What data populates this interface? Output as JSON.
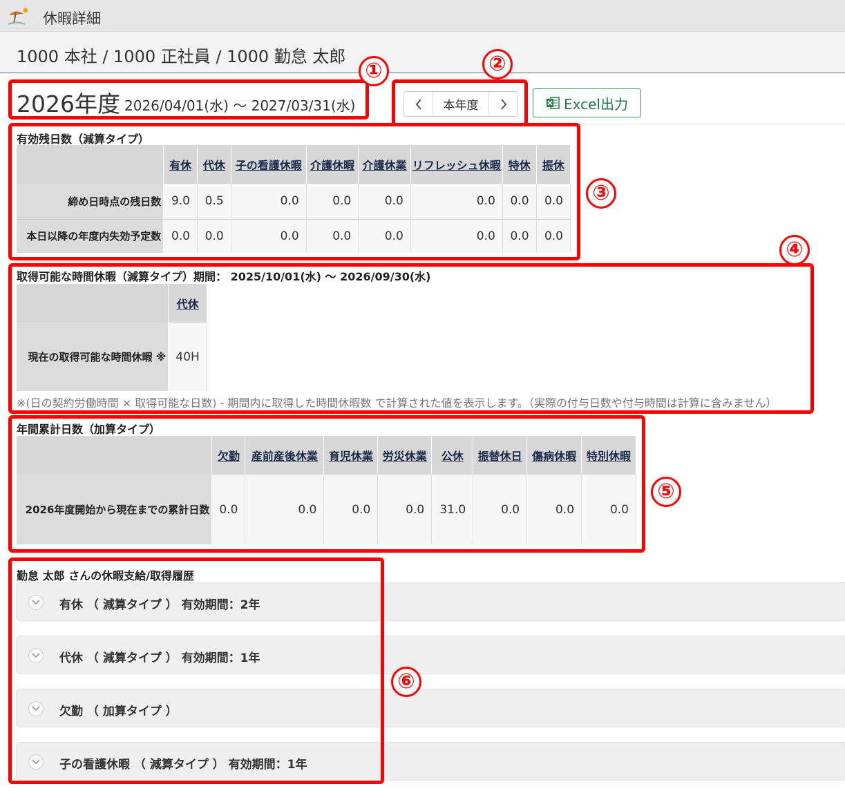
{
  "window": {
    "title": "休暇詳細",
    "logo_icon": "beach-umbrella-icon"
  },
  "employee": {
    "label": "1000 本社 / 1000 正社員 / 1000 勤怠 太郎"
  },
  "period": {
    "year": "2026年度",
    "range": "2026/04/01(水) ～ 2027/03/31(水)"
  },
  "nav": {
    "current_label": "本年度",
    "prev_icon": "chevron-left-icon",
    "next_icon": "chevron-right-icon"
  },
  "excel": {
    "label": "Excel出力",
    "icon": "excel-icon",
    "color": "#1f7a44"
  },
  "remaining": {
    "heading": "有効残日数（減算タイプ）",
    "columns": [
      "有休",
      "代休",
      "子の看護休暇",
      "介護休暇",
      "介護休業",
      "リフレッシュ休暇",
      "特休",
      "振休"
    ],
    "rows": [
      {
        "label": "締め日時点の残日数",
        "values": [
          "9.0",
          "0.5",
          "0.0",
          "0.0",
          "0.0",
          "0.0",
          "0.0",
          "0.0"
        ]
      },
      {
        "label": "本日以降の年度内失効予定数",
        "values": [
          "0.0",
          "0.0",
          "0.0",
          "0.0",
          "0.0",
          "0.0",
          "0.0",
          "0.0"
        ]
      }
    ]
  },
  "hourly": {
    "heading": "取得可能な時間休暇（減算タイプ）期間： 2025/10/01(水) ～ 2026/09/30(水)",
    "columns": [
      "代休"
    ],
    "row": {
      "label": "現在の取得可能な時間休暇 ※",
      "values": [
        "40H"
      ]
    },
    "note": "※(日の契約労働時間 × 取得可能な日数) - 期間内に取得した時間休暇数 で計算された値を表示します。（実際の付与日数や付与時間は計算に含みません）"
  },
  "cumulative": {
    "heading": "年間累計日数（加算タイプ）",
    "columns": [
      "欠勤",
      "産前産後休業",
      "育児休業",
      "労災休業",
      "公休",
      "振替休日",
      "傷病休暇",
      "特別休暇"
    ],
    "row": {
      "label": "2026年度開始から現在までの累計日数",
      "values": [
        "0.0",
        "0.0",
        "0.0",
        "0.0",
        "31.0",
        "0.0",
        "0.0",
        "0.0"
      ]
    }
  },
  "history": {
    "heading": "勤怠 太郎 さんの休暇支給/取得履歴",
    "items": [
      {
        "label": "有休 （ 減算タイプ ） 有効期間：2年"
      },
      {
        "label": "代休 （ 減算タイプ ） 有効期間：1年"
      },
      {
        "label": "欠勤 （ 加算タイプ ）"
      },
      {
        "label": "子の看護休暇 （ 減算タイプ ） 有効期間：1年"
      }
    ]
  },
  "annotations": {
    "markers": [
      "①",
      "②",
      "③",
      "④",
      "⑤",
      "⑥"
    ],
    "color": "#ff0000"
  }
}
